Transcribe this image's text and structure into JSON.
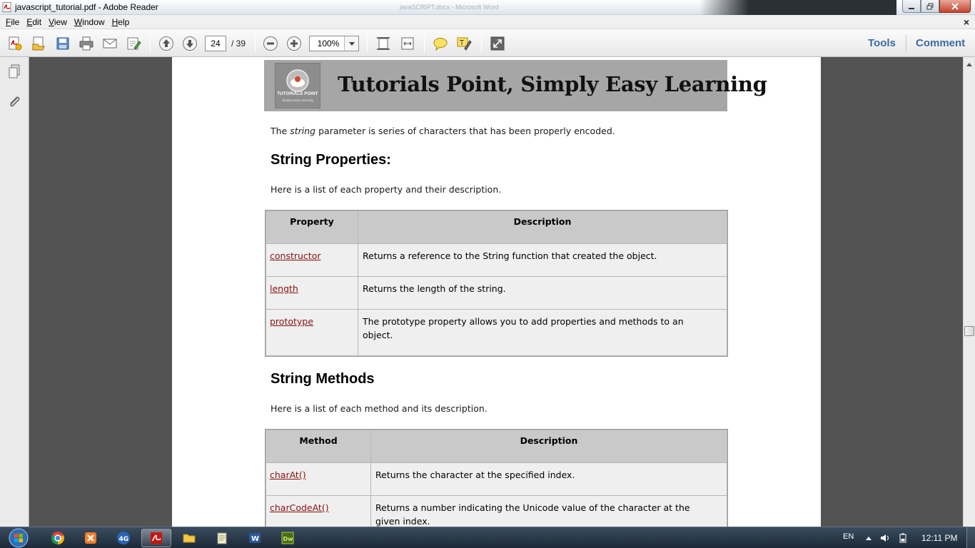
{
  "window": {
    "title": "javascript_tutorial.pdf - Adobe Reader",
    "background_title": "javaSCRIPT.docx - Microsoft Word"
  },
  "menu": {
    "items": [
      {
        "underline": "F",
        "rest": "ile"
      },
      {
        "underline": "E",
        "rest": "dit"
      },
      {
        "underline": "V",
        "rest": "iew"
      },
      {
        "underline": "W",
        "rest": "indow"
      },
      {
        "underline": "H",
        "rest": "elp"
      }
    ],
    "close_doc": "×"
  },
  "toolbar": {
    "current_page": "24",
    "total_pages": "/ 39",
    "zoom": "100%",
    "tools_label": "Tools",
    "comment_label": "Comment",
    "accent_color": "#3c6aa4"
  },
  "page": {
    "banner_title": "Tutorials Point, Simply Easy Learning",
    "logo_text": "TUTORIALS POINT",
    "logo_sub": "Simply Easy Learning",
    "intro_pre": "The ",
    "intro_em": "string",
    "intro_post": " parameter is series of characters that has been properly encoded.",
    "section1_heading": "String Properties:",
    "section1_intro": "Here is a list of each property and their description.",
    "properties_table": {
      "headers": [
        "Property",
        "Description"
      ],
      "rows": [
        {
          "name": "constructor",
          "desc": "Returns a reference to the String function that created the object."
        },
        {
          "name": "length",
          "desc": "Returns the length of the string."
        },
        {
          "name": "prototype",
          "desc": "The prototype property allows you to add properties and methods to an object."
        }
      ]
    },
    "section2_heading": "String Methods",
    "section2_intro": "Here is a list of each method and its description.",
    "methods_table": {
      "headers": [
        "Method",
        "Description"
      ],
      "rows": [
        {
          "name": "charAt()",
          "desc": "Returns the character at the specified index."
        },
        {
          "name": "charCodeAt()",
          "desc": "Returns a number indicating the Unicode value of the character at the given index."
        }
      ]
    },
    "link_color": "#8a1010"
  },
  "taskbar": {
    "apps": [
      "chrome-icon",
      "xampp-icon",
      "4g-icon",
      "adobe-reader-icon",
      "explorer-icon",
      "notepad-icon",
      "word-icon",
      "dreamweaver-icon"
    ],
    "language": "EN",
    "clock": "12:11 PM"
  }
}
